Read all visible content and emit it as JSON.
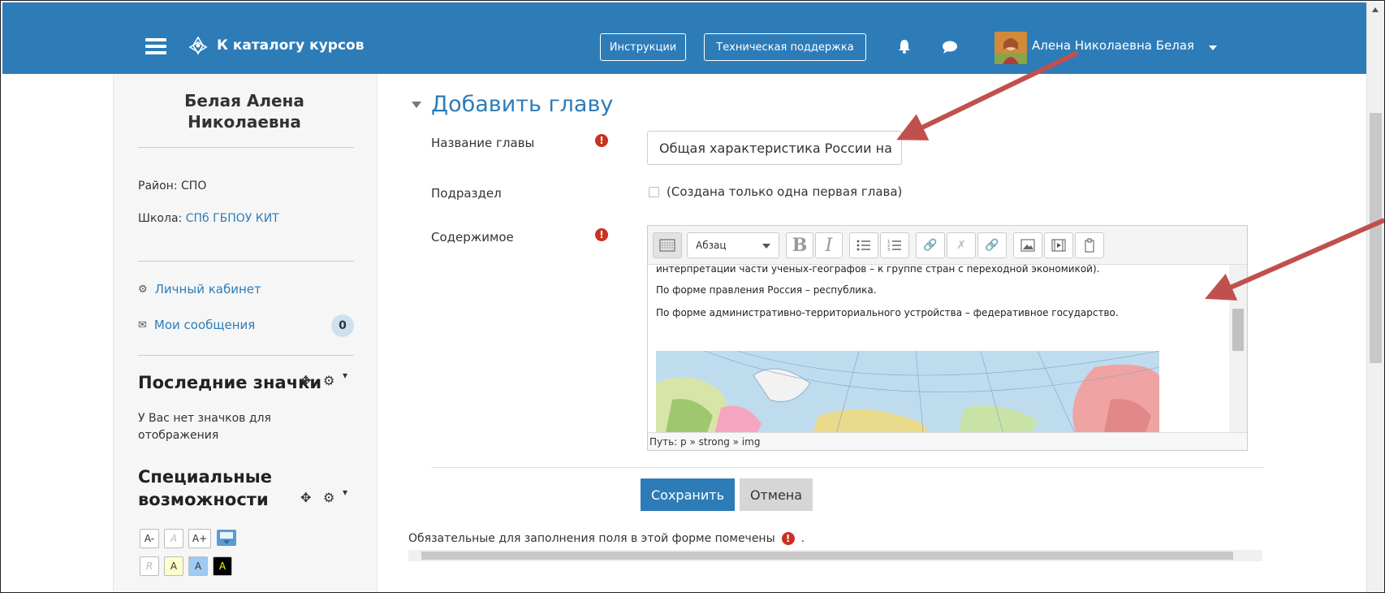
{
  "navbar": {
    "brand_label": "К каталогу курсов",
    "instructions_label": "Инструкции",
    "support_label": "Техническая поддержка",
    "user_name": "Алена Николаевна Белая",
    "bg_color": "#2d7cb8"
  },
  "sidebar": {
    "profile_name": "Белая Алена Николаевна",
    "district_label": "Район:",
    "district_value": "СПО",
    "school_label": "Школа:",
    "school_value": "СПб ГБПОУ КИТ",
    "cabinet_link": "Личный кабинет",
    "messages_link": "Мои сообщения",
    "messages_count": "0",
    "badges_block_title": "Последние значки",
    "badges_empty_text": "У Вас нет значков для отображения",
    "accessibility_block_title": "Специальные возможности",
    "accessibility_buttons": [
      "A-",
      "A",
      "A+"
    ],
    "color_buttons": [
      "R",
      "A",
      "A",
      "A"
    ]
  },
  "main": {
    "section_title": "Добавить главу",
    "chapter_name_label": "Название главы",
    "chapter_name_value": "Общая характеристика России на",
    "subchapter_label": "Подраздел",
    "subchapter_checkbox_label": "(Создана только одна первая глава)",
    "content_label": "Содержимое",
    "editor": {
      "paragraph_select": "Абзац",
      "lines": [
        "интерпретации части ученых-географов – к группе стран с переходной экономикой).",
        "По форме правления Россия – республика.",
        "По форме административно-территориального устройства – федеративное государство."
      ],
      "path_text": "Путь: p » strong » img"
    },
    "save_button": "Сохранить",
    "cancel_button": "Отмена",
    "required_note": "Обязательные для заполнения поля в этой форме помечены",
    "required_note_suffix": "."
  },
  "colors": {
    "accent": "#2d7cb8",
    "required": "#ca3120",
    "annotation_arrow": "#c0504d"
  }
}
